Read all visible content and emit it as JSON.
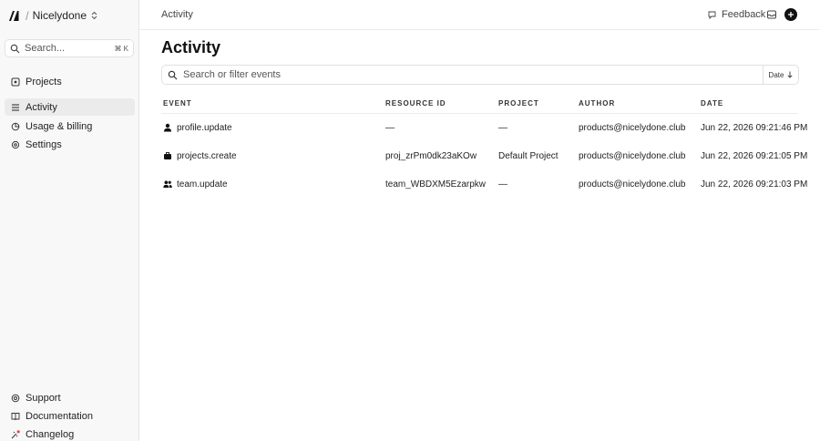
{
  "team": {
    "name": "Nicelydone",
    "separator": "/"
  },
  "sidebar": {
    "search_placeholder": "Search...",
    "shortcut": "⌘ K",
    "items": [
      {
        "label": "Projects",
        "icon": "projects-icon"
      },
      {
        "label": "Activity",
        "icon": "activity-icon",
        "active": true
      },
      {
        "label": "Usage & billing",
        "icon": "billing-icon"
      },
      {
        "label": "Settings",
        "icon": "settings-icon"
      }
    ],
    "bottom_items": [
      {
        "label": "Support",
        "icon": "support-icon"
      },
      {
        "label": "Documentation",
        "icon": "docs-icon"
      },
      {
        "label": "Changelog",
        "icon": "changelog-icon"
      }
    ]
  },
  "header": {
    "breadcrumb": "Activity",
    "feedback_label": "Feedback"
  },
  "main": {
    "title": "Activity",
    "filter_placeholder": "Search or filter events",
    "date_label": "Date"
  },
  "table": {
    "columns": [
      "EVENT",
      "RESOURCE ID",
      "PROJECT",
      "AUTHOR",
      "DATE"
    ],
    "rows": [
      {
        "event": "profile.update",
        "icon": "user-icon",
        "resource_id": "—",
        "project": "—",
        "author": "products@nicelydone.club",
        "date": "Jun 22, 2026 09:21:46 PM"
      },
      {
        "event": "projects.create",
        "icon": "briefcase-icon",
        "resource_id": "proj_zrPm0dk23aKOw",
        "project": "Default Project",
        "author": "products@nicelydone.club",
        "date": "Jun 22, 2026 09:21:05 PM"
      },
      {
        "event": "team.update",
        "icon": "users-icon",
        "resource_id": "team_WBDXM5Ezarpkw",
        "project": "—",
        "author": "products@nicelydone.club",
        "date": "Jun 22, 2026 09:21:03 PM"
      }
    ]
  },
  "colors": {
    "accent_dot": "#e5484d",
    "sidebar_bg": "#f8f8f8",
    "active_bg": "#ebebeb"
  }
}
